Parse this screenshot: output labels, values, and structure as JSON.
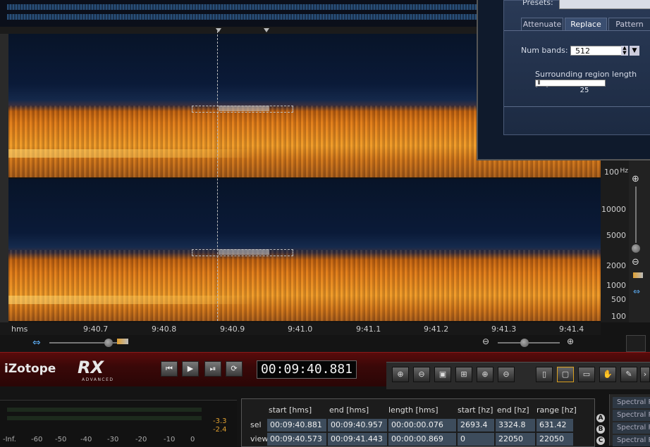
{
  "app": {
    "brand": "iZotope",
    "product": "RX",
    "edition": "ADVANCED"
  },
  "dialog": {
    "presets_label": "Presets:",
    "tabs": [
      "Attenuate",
      "Replace",
      "Pattern"
    ],
    "active_tab": "Replace",
    "num_bands_label": "Num bands:",
    "num_bands_value": "512",
    "surrounding_label": "Surrounding region length [%]",
    "surrounding_value": "25"
  },
  "time_axis": {
    "unit": "hms",
    "ticks": [
      "9:40.7",
      "9:40.8",
      "9:40.9",
      "9:41.0",
      "9:41.1",
      "9:41.2",
      "9:41.3",
      "9:41.4"
    ]
  },
  "freq_axis": {
    "unit": "Hz",
    "top_channel": [
      "100"
    ],
    "bottom_channel": [
      "10000",
      "5000",
      "2000",
      "1000",
      "500",
      "100"
    ]
  },
  "transport": {
    "timecode": "00:09:40.881",
    "buttons": {
      "to_start": "⏮",
      "play": "▶",
      "play_sel": "⏯",
      "loop": "⟳"
    }
  },
  "meter": {
    "scale": [
      "-Inf.",
      "-60",
      "-50",
      "-40",
      "-30",
      "-20",
      "-10",
      "0"
    ],
    "peak_top": "-3.3",
    "peak_bottom": "-2.4"
  },
  "selection_info": {
    "headers": [
      "start [hms]",
      "end [hms]",
      "length [hms]",
      "start [hz]",
      "end [hz]",
      "range [hz]"
    ],
    "rows": [
      {
        "label": "sel",
        "values": [
          "00:09:40.881",
          "00:09:40.957",
          "00:00:00.076",
          "2693.4",
          "3324.8",
          "631.42"
        ]
      },
      {
        "label": "view",
        "values": [
          "00:09:40.573",
          "00:09:41.443",
          "00:00:00.869",
          "0",
          "22050",
          "22050"
        ]
      }
    ]
  },
  "side_list": {
    "items": [
      "Spectral R",
      "Spectral R",
      "Spectral R",
      "Spectral R"
    ],
    "letters": [
      "A",
      "B",
      "C"
    ]
  },
  "colors": {
    "accent_red": "#5a0b0b",
    "spectrogram_low": "#081428",
    "spectrogram_high": "#f09a28",
    "peak": "#e0a030"
  }
}
